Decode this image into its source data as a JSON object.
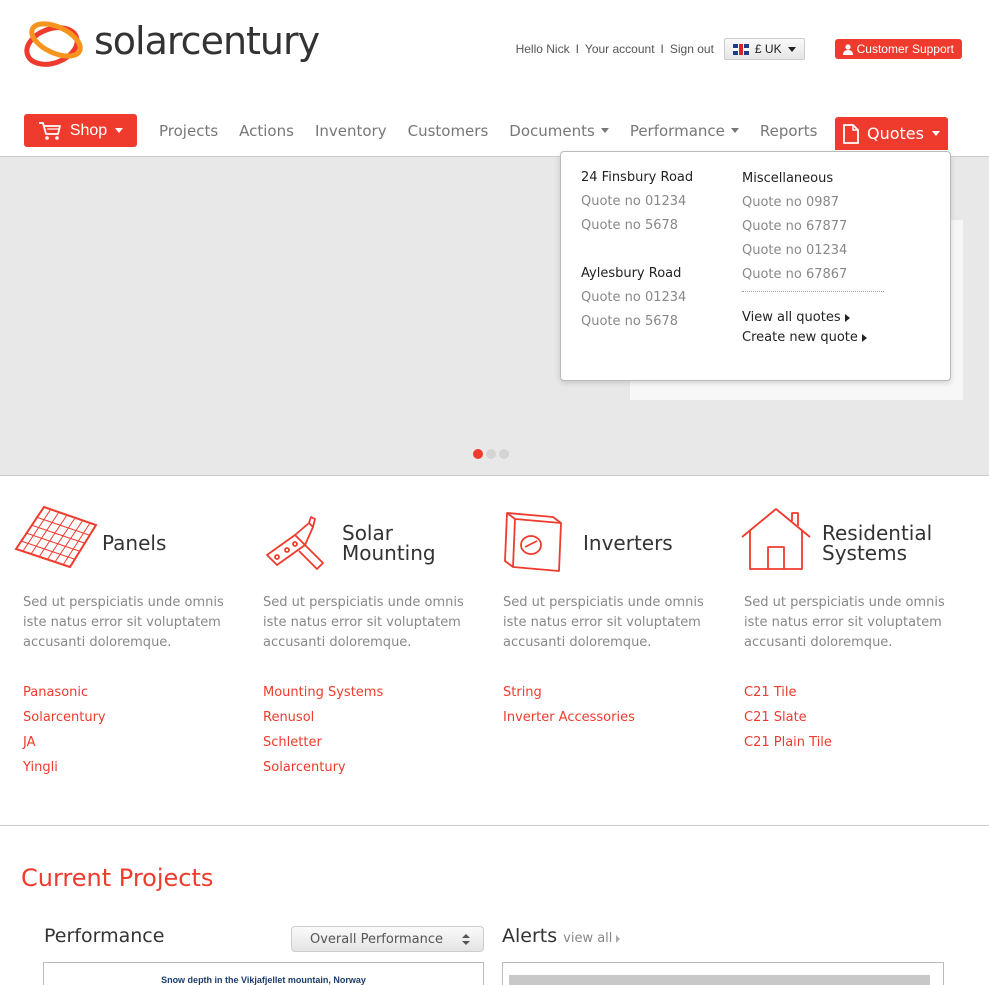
{
  "brand": {
    "name": "solarcentury",
    "accent": "#ef3b2d",
    "logo_orange": "#f7941d"
  },
  "userbar": {
    "greeting": "Hello Nick",
    "separator": "I",
    "account": "Your account",
    "signout": "Sign out",
    "currency": "£ UK",
    "support": "Customer Support"
  },
  "nav": {
    "shop": "Shop",
    "items": [
      "Projects",
      "Actions",
      "Inventory",
      "Customers",
      "Documents",
      "Performance",
      "Reports"
    ],
    "quotes": "Quotes"
  },
  "quotes_menu": {
    "group1": {
      "title": "24 Finsbury Road",
      "items": [
        "Quote no  01234",
        "Quote no  5678"
      ]
    },
    "group2": {
      "title": "Aylesbury Road",
      "items": [
        "Quote no  01234",
        "Quote no  5678"
      ]
    },
    "group3": {
      "title": "Miscellaneous",
      "items": [
        "Quote no  0987",
        "Quote no  67877",
        "Quote no  01234",
        "Quote no  67867"
      ]
    },
    "view_all": "View all quotes",
    "create_new": "Create new quote"
  },
  "carousel": {
    "slides": 3,
    "active": 1
  },
  "categories": [
    {
      "title_line1": "Panels",
      "title_line2": "",
      "icon": "solar-panel-icon",
      "desc": "Sed ut perspiciatis unde omnis iste natus error sit voluptatem accusanti doloremque.",
      "links": [
        "Panasonic",
        "Solarcentury",
        "JA",
        "Yingli"
      ]
    },
    {
      "title_line1": "Solar",
      "title_line2": "Mounting",
      "icon": "mounting-icon",
      "desc": "Sed ut perspiciatis unde omnis iste natus error sit voluptatem accusanti doloremque.",
      "links": [
        "Mounting Systems",
        "Renusol",
        "Schletter",
        "Solarcentury"
      ]
    },
    {
      "title_line1": "Inverters",
      "title_line2": "",
      "icon": "inverter-icon",
      "desc": "Sed ut perspiciatis unde omnis iste natus error sit voluptatem accusanti doloremque.",
      "links": [
        "String",
        "Inverter Accessories"
      ]
    },
    {
      "title_line1": "Residential",
      "title_line2": "Systems",
      "icon": "house-icon",
      "desc": "Sed ut perspiciatis unde omnis iste natus error sit voluptatem accusanti doloremque.",
      "links": [
        "C21 Tile",
        "C21 Slate",
        "C21 Plain Tile"
      ]
    }
  ],
  "projects": {
    "section_title": "Current Projects",
    "performance_title": "Performance",
    "performance_select": "Overall Performance",
    "chart_title": "Snow depth in the Vikjafjellet mountain, Norway",
    "alerts_title": "Alerts",
    "alerts_viewall": "view all"
  }
}
